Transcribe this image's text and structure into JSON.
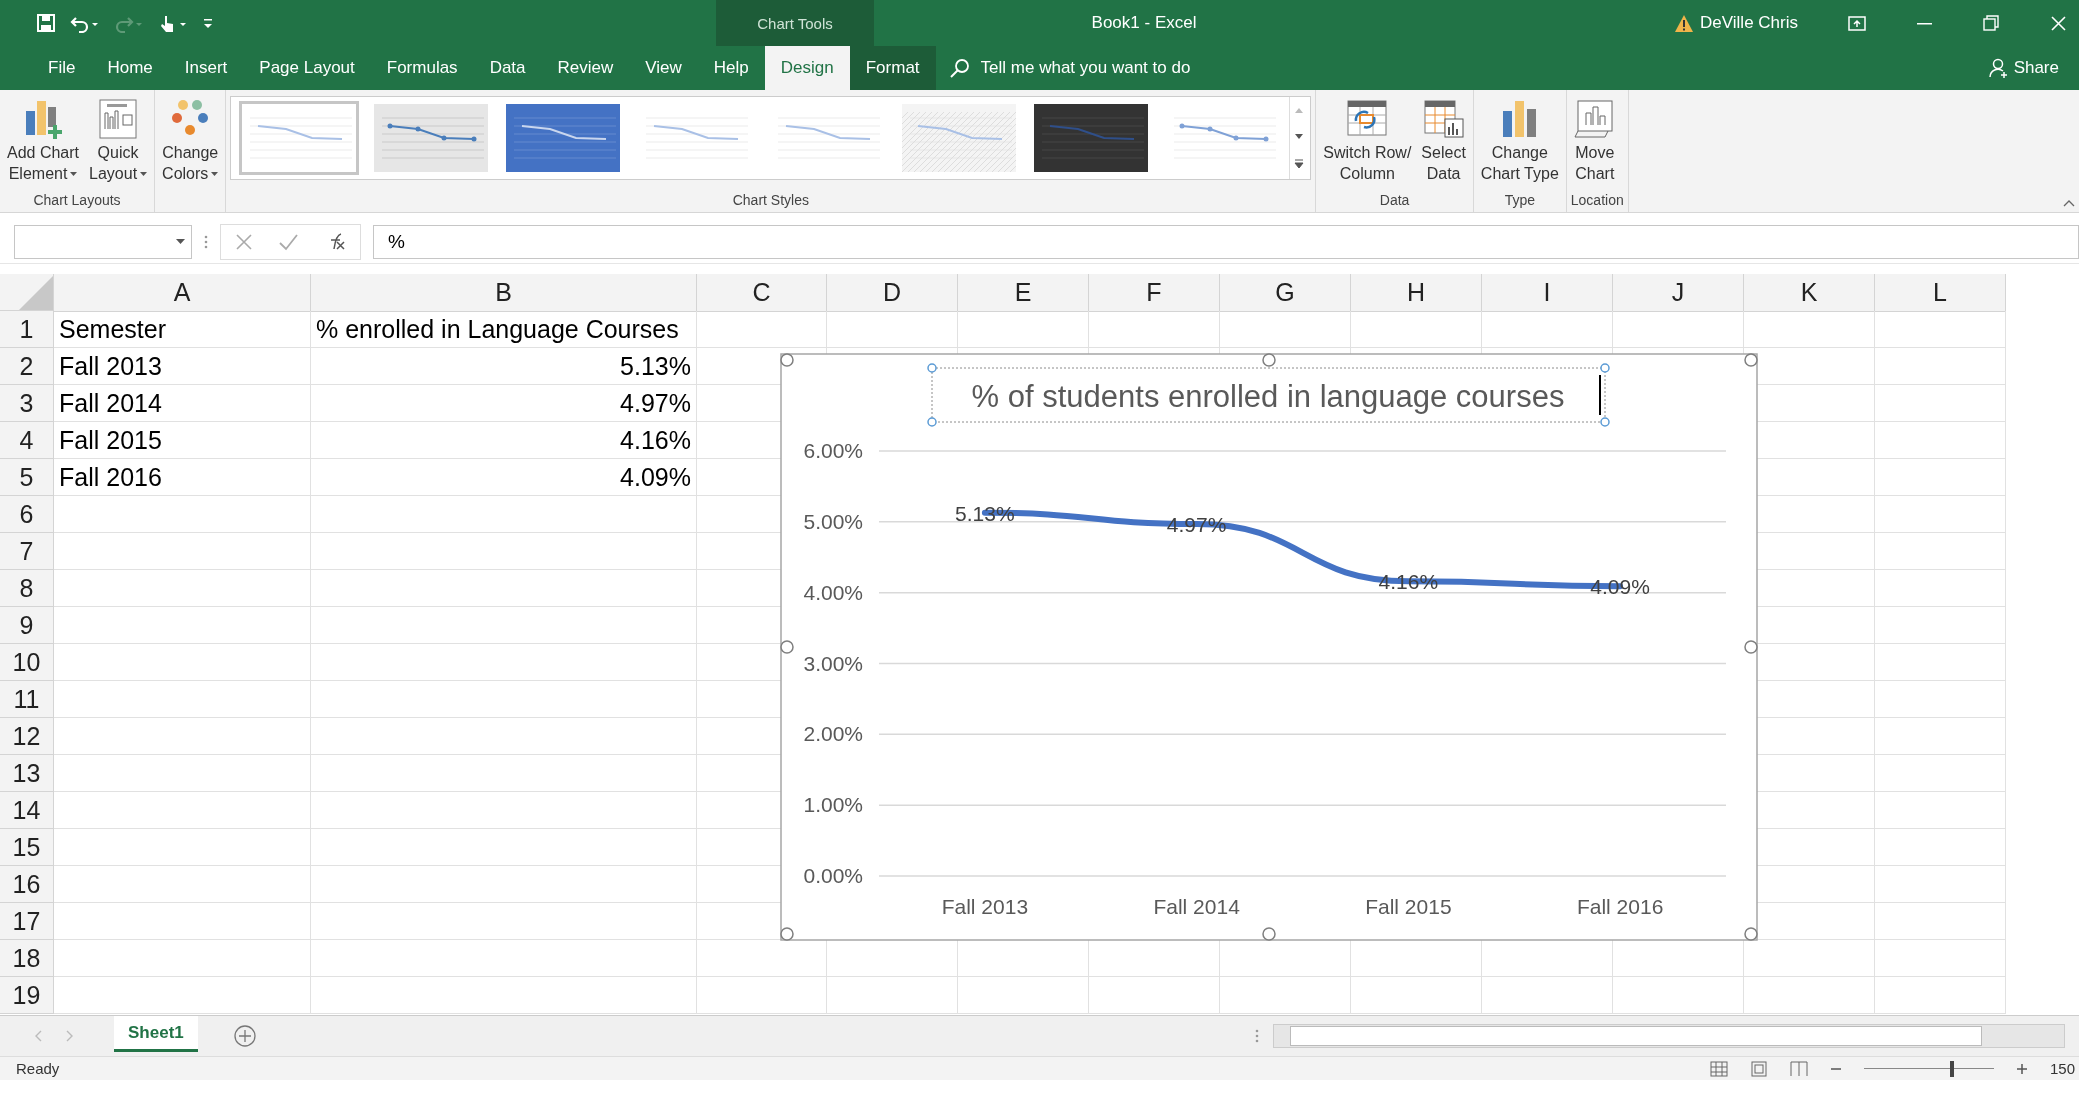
{
  "title_bar": {
    "context_group": "Chart Tools",
    "title": "Book1  -  Excel",
    "user": "DeVille Chris"
  },
  "ribbon_tabs": [
    {
      "label": "File",
      "kind": "normal",
      "selected": false
    },
    {
      "label": "Home",
      "kind": "normal",
      "selected": false
    },
    {
      "label": "Insert",
      "kind": "normal",
      "selected": false
    },
    {
      "label": "Page Layout",
      "kind": "normal",
      "selected": false
    },
    {
      "label": "Formulas",
      "kind": "normal",
      "selected": false
    },
    {
      "label": "Data",
      "kind": "normal",
      "selected": false
    },
    {
      "label": "Review",
      "kind": "normal",
      "selected": false
    },
    {
      "label": "View",
      "kind": "normal",
      "selected": false
    },
    {
      "label": "Help",
      "kind": "normal",
      "selected": false
    },
    {
      "label": "Design",
      "kind": "contextual",
      "selected": true
    },
    {
      "label": "Format",
      "kind": "contextual",
      "selected": false
    }
  ],
  "tell_me": {
    "placeholder": "Tell me what you want to do"
  },
  "share": "Share",
  "ribbon_groups": [
    {
      "label": "Chart Layouts",
      "kind": "buttons",
      "buttons": [
        {
          "lines": [
            "Add Chart",
            "Element"
          ],
          "dropdown": true
        },
        {
          "lines": [
            "Quick",
            "Layout"
          ],
          "dropdown": true
        }
      ]
    },
    {
      "kind": "buttons",
      "buttons": [
        {
          "lines": [
            "Change",
            "Colors"
          ],
          "dropdown": true
        }
      ]
    },
    {
      "label": "Chart Styles",
      "kind": "gallery",
      "styles": [
        {
          "kind": "plain",
          "selected": true
        },
        {
          "kind": "gray",
          "selected": false
        },
        {
          "kind": "blue",
          "selected": false
        },
        {
          "kind": "plain",
          "selected": false
        },
        {
          "kind": "plain",
          "selected": false
        },
        {
          "kind": "hatched",
          "selected": false
        },
        {
          "kind": "dark",
          "selected": false
        },
        {
          "kind": "markers",
          "selected": false
        }
      ]
    },
    {
      "label": "Data",
      "kind": "buttons",
      "buttons": [
        {
          "lines": [
            "Switch Row/",
            "Column"
          ],
          "dropdown": false
        },
        {
          "lines": [
            "Select",
            "Data"
          ],
          "dropdown": false
        }
      ]
    },
    {
      "label": "Type",
      "kind": "buttons",
      "buttons": [
        {
          "lines": [
            "Change",
            "Chart Type"
          ],
          "dropdown": false
        }
      ]
    },
    {
      "label": "Location",
      "kind": "buttons",
      "buttons": [
        {
          "lines": [
            "Move",
            "Chart"
          ],
          "dropdown": false
        }
      ]
    }
  ],
  "formula_bar": {
    "formula": "%"
  },
  "columns": [
    "A",
    "B",
    "C",
    "D",
    "E",
    "F",
    "G",
    "H",
    "I",
    "J",
    "K",
    "L"
  ],
  "rows": [
    "1",
    "2",
    "3",
    "4",
    "5",
    "6",
    "7",
    "8",
    "9",
    "10",
    "11",
    "12",
    "13",
    "14",
    "15",
    "16",
    "17",
    "18",
    "19"
  ],
  "cells": [
    [
      "Semester",
      "% enrolled in Language Courses"
    ],
    [
      "Fall 2013",
      "5.13%"
    ],
    [
      "Fall 2014",
      "4.97%"
    ],
    [
      "Fall 2015",
      "4.16%"
    ],
    [
      "Fall 2016",
      "4.09%"
    ]
  ],
  "chart": {
    "selected": true,
    "title_selected": true,
    "chart_data": {
      "type": "line",
      "title": "% of students enrolled in language courses",
      "categories": [
        "Fall 2013",
        "Fall 2014",
        "Fall 2015",
        "Fall 2016"
      ],
      "series": [
        {
          "color": "#4472c4",
          "values": [
            5.13,
            4.97,
            4.16,
            4.09
          ]
        }
      ],
      "ylim": [
        0,
        6
      ],
      "grid": true,
      "yticks": [
        {
          "value": 0,
          "label": "0.00%"
        },
        {
          "value": 1,
          "label": "1.00%"
        },
        {
          "value": 2,
          "label": "2.00%"
        },
        {
          "value": 3,
          "label": "3.00%"
        },
        {
          "value": 4,
          "label": "4.00%"
        },
        {
          "value": 5,
          "label": "5.00%"
        },
        {
          "value": 6,
          "label": "6.00%"
        }
      ],
      "value_labels": [
        "5.13%",
        "4.97%",
        "4.16%",
        "4.09%"
      ]
    }
  },
  "sheet_tabs": [
    {
      "label": "Sheet1",
      "selected": true
    }
  ],
  "status_bar": {
    "status": "Ready",
    "zoom": "150",
    "level": 0.68
  }
}
